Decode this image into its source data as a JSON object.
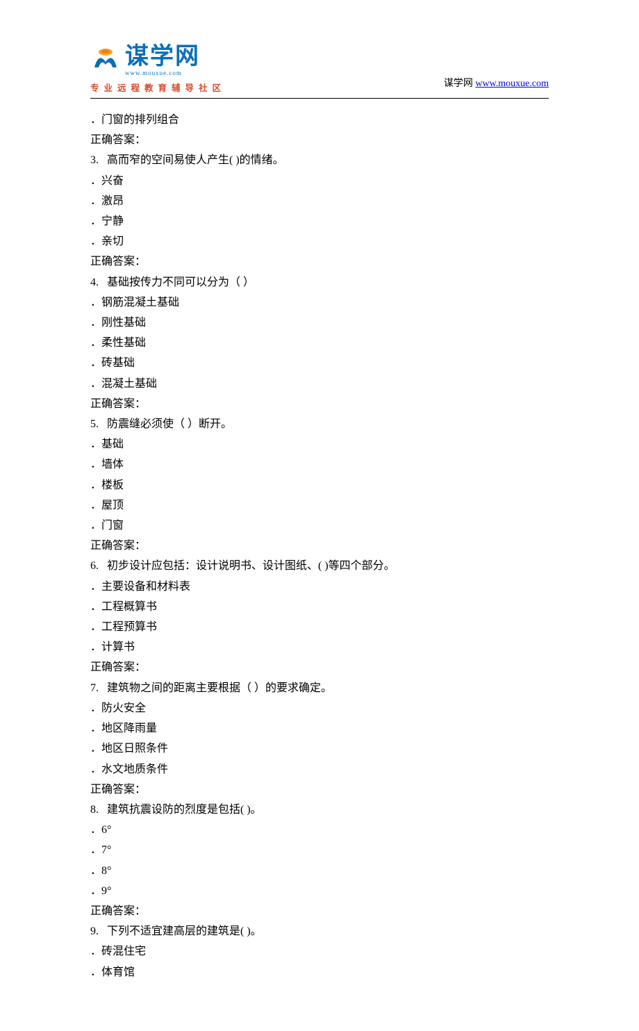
{
  "header": {
    "logo_main": "谋学网",
    "logo_sub": "www.mouxue.com",
    "logo_tagline": "专业远程教育辅导社区",
    "right_label": "谋学网 ",
    "right_link": "www.mouxue.com"
  },
  "lines": [
    "．门窗的排列组合",
    "正确答案：",
    "3.   高而窄的空间易使人产生( )的情绪。",
    "．兴奋",
    "．激昂",
    "．宁静",
    "．亲切",
    "正确答案：",
    "4.   基础按传力不同可以分为（ ）",
    "．钢筋混凝土基础",
    "．刚性基础",
    "．柔性基础",
    "．砖基础",
    "．混凝土基础",
    "正确答案：",
    "5.   防震缝必须使（ ）断开。",
    "．基础",
    "．墙体",
    "．楼板",
    "．屋顶",
    "．门窗",
    "正确答案：",
    "6.   初步设计应包括：设计说明书、设计图纸、( )等四个部分。",
    "．主要设备和材料表",
    "．工程概算书",
    "．工程预算书",
    "．计算书",
    "正确答案：",
    "7.   建筑物之间的距离主要根据（ ）的要求确定。",
    "．防火安全",
    "．地区降雨量",
    "．地区日照条件",
    "．水文地质条件",
    "正确答案：",
    "8.   建筑抗震设防的烈度是包括( )。",
    "．6°",
    "．7°",
    "．8°",
    "．9°",
    "正确答案：",
    "9.   下列不适宜建高层的建筑是( )。",
    "．砖混住宅",
    "．体育馆"
  ]
}
